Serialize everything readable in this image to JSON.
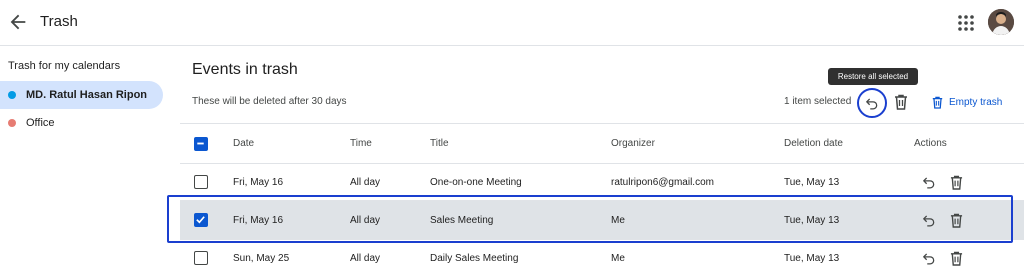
{
  "header": {
    "title": "Trash",
    "back_icon": "arrow-back-icon",
    "apps_icon": "apps-grid-icon"
  },
  "sidebar": {
    "heading": "Trash for my calendars",
    "calendars": [
      {
        "label": "MD. Ratul Hasan Ripon",
        "color": "#039be5",
        "active": true
      },
      {
        "label": "Office",
        "color": "#e67c73",
        "active": false
      }
    ]
  },
  "main": {
    "title": "Events in trash",
    "subtitle": "These will be deleted after 30 days",
    "selected_count": "1 item selected",
    "tooltip": "Restore all selected",
    "empty_trash": "Empty trash",
    "accent": "#0b57d0"
  },
  "table": {
    "columns": [
      "Date",
      "Time",
      "Title",
      "Organizer",
      "Deletion date",
      "Actions"
    ],
    "rows": [
      {
        "date": "Fri, May 16",
        "time": "All day",
        "title": "One-on-one Meeting",
        "organizer": "ratulripon6@gmail.com",
        "deletion": "Tue, May 13",
        "checked": false
      },
      {
        "date": "Fri, May 16",
        "time": "All day",
        "title": "Sales Meeting",
        "organizer": "Me",
        "deletion": "Tue, May 13",
        "checked": true
      },
      {
        "date": "Sun, May 25",
        "time": "All day",
        "title": "Daily Sales Meeting",
        "organizer": "Me",
        "deletion": "Tue, May 13",
        "checked": false
      }
    ]
  }
}
